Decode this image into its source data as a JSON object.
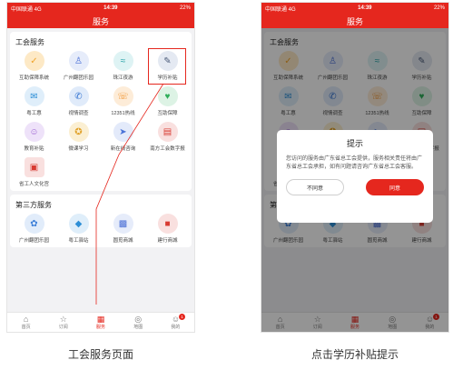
{
  "status_bar": {
    "carrier": "中国联通 4G",
    "time": "14:39",
    "battery": "22%"
  },
  "nav_title": "服务",
  "section_union": "工会服务",
  "union_services": [
    {
      "label": "互助保障系统",
      "icon": "shield-icon",
      "color": "#f0a32a",
      "bg": "#fde9c6"
    },
    {
      "label": "广州翻团乐园",
      "icon": "person-icon",
      "color": "#4a6fd6",
      "bg": "#e6ecfa"
    },
    {
      "label": "珠江夜游",
      "icon": "boat-icon",
      "color": "#29a3a8",
      "bg": "#def3f4"
    },
    {
      "label": "学历补贴",
      "icon": "graduate-icon",
      "color": "#4a5a78",
      "bg": "#e4e9f2"
    },
    {
      "label": "粤工惠",
      "icon": "gift-icon",
      "color": "#2e8fd6",
      "bg": "#dfeefa"
    },
    {
      "label": "视情调查",
      "icon": "chat-icon",
      "color": "#2d6fd0",
      "bg": "#e0ebfa"
    },
    {
      "label": "12351热线",
      "icon": "phone-icon",
      "color": "#f0922b",
      "bg": "#fdecd8"
    },
    {
      "label": "互助保障",
      "icon": "heart-shield-icon",
      "color": "#2fae5a",
      "bg": "#ddf3e5"
    },
    {
      "label": "教育补贴",
      "icon": "user-icon",
      "color": "#9a5fd1",
      "bg": "#eee2f9"
    },
    {
      "label": "微课学习",
      "icon": "medal-icon",
      "color": "#e0a12a",
      "bg": "#fbefd2"
    },
    {
      "label": "新在线咨询",
      "icon": "send-icon",
      "color": "#4b74d8",
      "bg": "#e3eafa"
    },
    {
      "label": "南方工会数字报",
      "icon": "news-icon",
      "color": "#d83b32",
      "bg": "#f9e0df"
    },
    {
      "label": "省工人文化宫",
      "icon": "building-icon",
      "color": "#d83b32",
      "bg": "#f9e0df"
    }
  ],
  "section_third": "第三方服务",
  "third_services": [
    {
      "label": "广州翻团乐园",
      "icon": "flower-icon",
      "color": "#3c7fd8",
      "bg": "#e1ecfa"
    },
    {
      "label": "粤工驿站",
      "icon": "station-icon",
      "color": "#2e8fd6",
      "bg": "#dfeefa"
    },
    {
      "label": "圆觅商城",
      "icon": "cart-icon",
      "color": "#4a6fd6",
      "bg": "#e6ecfa"
    },
    {
      "label": "建行商城",
      "icon": "mall-icon",
      "color": "#d83b32",
      "bg": "#f9e0df"
    }
  ],
  "tabs": [
    {
      "label": "首页",
      "icon": "home-icon",
      "glyph": "⌂"
    },
    {
      "label": "订阅",
      "icon": "star-icon",
      "glyph": "☆"
    },
    {
      "label": "服务",
      "icon": "grid-icon",
      "glyph": "▦"
    },
    {
      "label": "地图",
      "icon": "compass-icon",
      "glyph": "◎"
    },
    {
      "label": "我的",
      "icon": "profile-icon",
      "glyph": "☺",
      "badge": "1"
    }
  ],
  "dialog": {
    "title": "提示",
    "message": "您访问的服务由广东省总工会提供，服务相关责任将由广东省总工会承担，如有问题请咨询广东省总工会客服。",
    "cancel": "不同意",
    "confirm": "同意"
  },
  "captions": {
    "left": "工会服务页面",
    "right": "点击学历补贴提示"
  },
  "accent_color": "#e5271e"
}
